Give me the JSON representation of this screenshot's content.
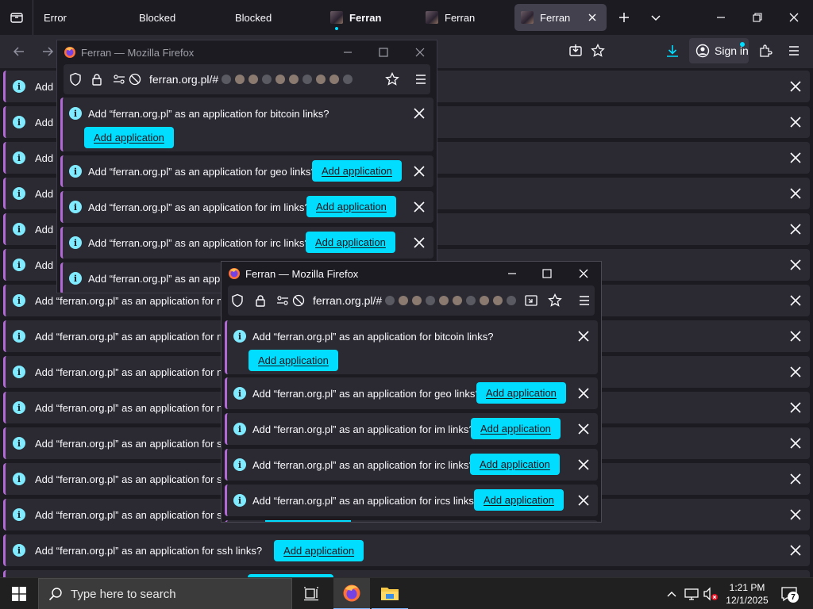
{
  "tabs": [
    {
      "label": "Error"
    },
    {
      "label": "Blocked"
    },
    {
      "label": "Blocked"
    },
    {
      "label": "Ferran"
    },
    {
      "label": "Ferran"
    },
    {
      "label": "Ferran"
    }
  ],
  "toolbar": {
    "sign_in": "Sign in"
  },
  "main_bars": [
    {
      "text": "Add “f"
    },
    {
      "text": "Add “f"
    },
    {
      "text": "Add “f"
    },
    {
      "text": "Add “f"
    },
    {
      "text": "Add “f"
    },
    {
      "text": "Add “f"
    },
    {
      "text": "Add “ferran.org.pl” as an application for mailt"
    },
    {
      "text": "Add “ferran.org.pl” as an application for mms"
    },
    {
      "text": "Add “ferran.org.pl” as an application for news"
    },
    {
      "text": "Add “ferran.org.pl” as an application for nntp"
    },
    {
      "text": "Add “ferran.org.pl” as an application for sip lir"
    },
    {
      "text": "Add “ferran.org.pl” as an application for sms li"
    },
    {
      "text": "Add “ferran.org.pl” as an application for smsto"
    },
    {
      "text": "Add “ferran.org.pl” as an application for ssh links?",
      "button": "Add application"
    },
    {
      "text": ""
    }
  ],
  "popup1": {
    "title": "Ferran — Mozilla Firefox",
    "url": "ferran.org.pl/#",
    "bars": [
      {
        "text": "Add “ferran.org.pl” as an application for bitcoin links?",
        "button": "Add application"
      },
      {
        "text": "Add “ferran.org.pl” as an application for geo links?",
        "button": "Add application"
      },
      {
        "text": "Add “ferran.org.pl” as an application for im links?",
        "button": "Add application"
      },
      {
        "text": "Add “ferran.org.pl” as an application for irc links?",
        "button": "Add application"
      },
      {
        "text": "Add “ferran.org.pl” as an applica"
      }
    ]
  },
  "popup2": {
    "title": "Ferran — Mozilla Firefox",
    "url": "ferran.org.pl/#",
    "bars": [
      {
        "text": "Add “ferran.org.pl” as an application for bitcoin links?",
        "button": "Add application"
      },
      {
        "text": "Add “ferran.org.pl” as an application for geo links?",
        "button": "Add application"
      },
      {
        "text": "Add “ferran.org.pl” as an application for im links?",
        "button": "Add application"
      },
      {
        "text": "Add “ferran.org.pl” as an application for irc links?",
        "button": "Add application"
      },
      {
        "text": "Add “ferran.org.pl” as an application for ircs links?",
        "button": "Add application"
      }
    ]
  },
  "taskbar": {
    "search_placeholder": "Type here to search",
    "time": "1:21 PM",
    "date": "12/1/2025",
    "notifications": "7"
  },
  "colors": {
    "accent": "#00ddff",
    "bar_stripe": "#b16ad4",
    "chrome": "#2b2a33",
    "background": "#1c1b22"
  },
  "icons": [
    "tab-list-icon",
    "new-tab-icon",
    "list-all-tabs-icon",
    "minimize-icon",
    "maximize-icon",
    "close-icon",
    "back-icon",
    "forward-icon",
    "save-to-pocket-icon",
    "bookmark-star-icon",
    "downloads-icon",
    "account-icon",
    "extensions-icon",
    "menu-icon",
    "info-icon",
    "shield-icon",
    "lock-icon",
    "permissions-icon",
    "tracking-icon",
    "firefox-icon",
    "windows-start-icon",
    "search-icon",
    "task-view-icon",
    "file-explorer-icon",
    "chevron-up-icon",
    "network-icon",
    "volume-icon",
    "notification-icon"
  ]
}
